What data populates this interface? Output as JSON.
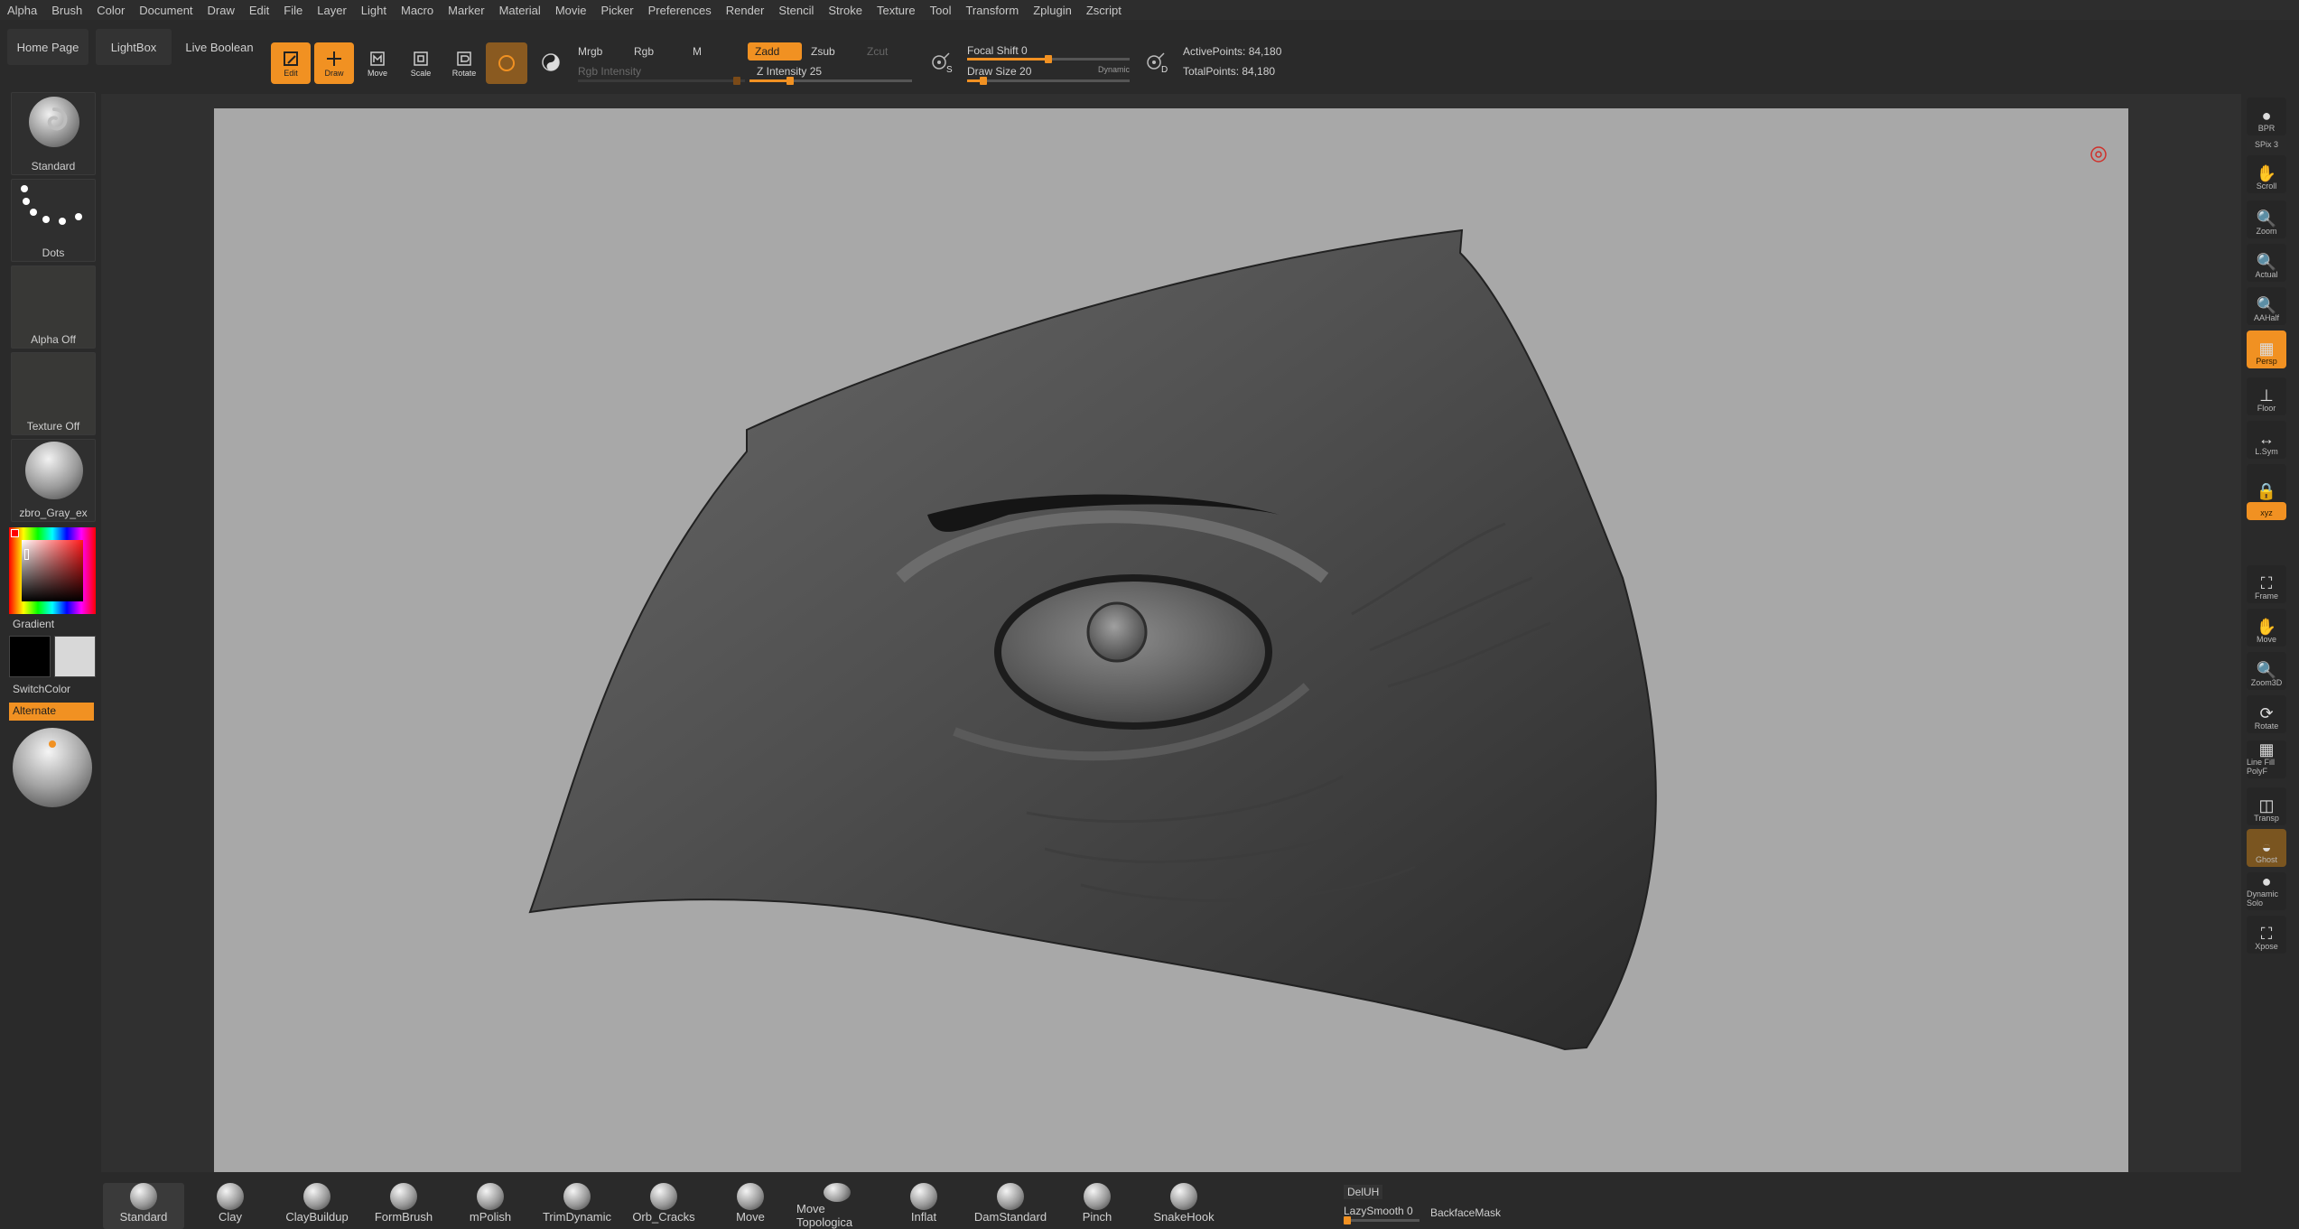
{
  "menu": [
    "Alpha",
    "Brush",
    "Color",
    "Document",
    "Draw",
    "Edit",
    "File",
    "Layer",
    "Light",
    "Macro",
    "Marker",
    "Material",
    "Movie",
    "Picker",
    "Preferences",
    "Render",
    "Stencil",
    "Stroke",
    "Texture",
    "Tool",
    "Transform",
    "Zplugin",
    "Zscript"
  ],
  "topshelf": {
    "home_page": "Home Page",
    "lightbox": "LightBox",
    "live_boolean": "Live Boolean",
    "tools": [
      {
        "label": "Edit",
        "on": true
      },
      {
        "label": "Draw",
        "on": true
      },
      {
        "label": "Move",
        "on": false
      },
      {
        "label": "Scale",
        "on": false
      },
      {
        "label": "Rotate",
        "on": false
      }
    ],
    "mrgb": "Mrgb",
    "rgb": "Rgb",
    "m": "M",
    "rgb_intensity": "Rgb Intensity",
    "zadd": "Zadd",
    "zsub": "Zsub",
    "zcut": "Zcut",
    "z_intensity": "Z Intensity 25",
    "z_intensity_value": 25,
    "focal_shift": "Focal Shift 0",
    "focal_shift_value": 0,
    "draw_size": "Draw Size 20",
    "draw_size_value": 20,
    "dynamic": "Dynamic",
    "active_points": "ActivePoints: 84,180",
    "total_points": "TotalPoints: 84,180",
    "s_label": "S",
    "d_label": "D"
  },
  "leftpanel": {
    "brush": "Standard",
    "stroke": "Dots",
    "alpha": "Alpha Off",
    "texture": "Texture Off",
    "material": "zbro_Gray_ex",
    "gradient": "Gradient",
    "switchcolor": "SwitchColor",
    "alternate": "Alternate",
    "main_color": "#000000",
    "secondary_color": "#d8d8d8"
  },
  "rightpanel": {
    "items": [
      {
        "label": "BPR",
        "icon": "bpr-icon",
        "on": false
      },
      {
        "label": "SPix 3",
        "icon": "spix-icon",
        "on": false
      },
      {
        "label": "Scroll",
        "icon": "scroll-icon",
        "on": false
      },
      {
        "label": "Zoom",
        "icon": "zoom-icon",
        "on": false
      },
      {
        "label": "Actual",
        "icon": "actual-icon",
        "on": false
      },
      {
        "label": "AAHalf",
        "icon": "aahalf-icon",
        "on": false
      },
      {
        "label": "Persp",
        "icon": "persp-icon",
        "on": true
      },
      {
        "label": "Floor",
        "icon": "floor-icon",
        "on": false
      },
      {
        "label": "L.Sym",
        "icon": "lsym-icon",
        "on": false
      },
      {
        "label": "",
        "icon": "lock-icon",
        "on": false
      },
      {
        "label": "xyz",
        "icon": "xyz-icon",
        "on": true
      },
      {
        "label": "Frame",
        "icon": "frame-icon",
        "on": false
      },
      {
        "label": "Move",
        "icon": "move-icon",
        "on": false
      },
      {
        "label": "Zoom3D",
        "icon": "zoom3d-icon",
        "on": false
      },
      {
        "label": "Rotate",
        "icon": "rotate-icon",
        "on": false
      },
      {
        "label": "Line Fill PolyF",
        "icon": "polyf-icon",
        "on": false
      },
      {
        "label": "Transp",
        "icon": "transp-icon",
        "on": false
      },
      {
        "label": "Ghost",
        "icon": "ghost-icon",
        "on": false
      },
      {
        "label": "Dynamic Solo",
        "icon": "solo-icon",
        "on": false
      },
      {
        "label": "Xpose",
        "icon": "xpose-icon",
        "on": false
      }
    ]
  },
  "bottomshelf": {
    "brushes": [
      "Standard",
      "Clay",
      "ClayBuildup",
      "FormBrush",
      "mPolish",
      "TrimDynamic",
      "Orb_Cracks",
      "Move",
      "Move Topologica",
      "Inflat",
      "DamStandard",
      "Pinch",
      "SnakeHook"
    ],
    "deluh": "DelUH",
    "lazysmooth": "LazySmooth 0",
    "backfacemask": "BackfaceMask"
  },
  "colors": {
    "accent": "#f19122",
    "background": "#282828",
    "canvas": "#a8a8a8"
  }
}
